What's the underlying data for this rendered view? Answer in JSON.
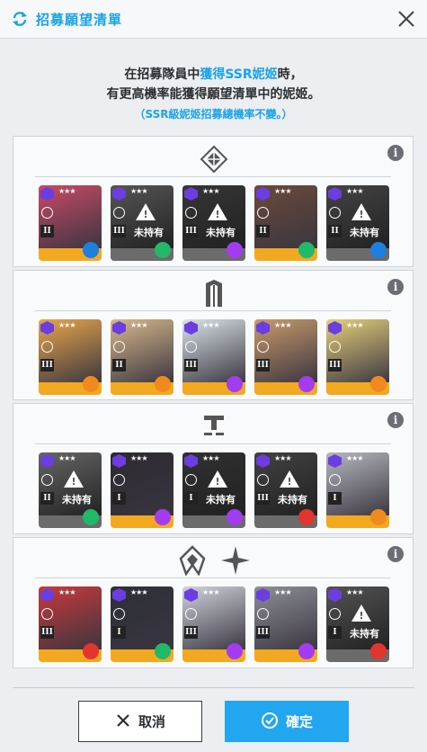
{
  "header": {
    "title": "招募願望清單",
    "refresh_icon": "refresh-icon",
    "close_icon": "close-icon"
  },
  "description": {
    "line1_prefix": "在招募隊員中",
    "line1_highlight": "獲得SSR妮姬",
    "line1_suffix": "時，",
    "line2": "有更高機率能獲得願望清單中的妮姬。",
    "note": "（SSR級妮姬招募總機率不變。）"
  },
  "colors": {
    "accent": "#1aa3e8",
    "owned_bar": "#f2a91f",
    "unowned_bar": "#6b6b6b",
    "burst_purple": "#7b2ff0",
    "electric": "#a33cf0",
    "fire": "#e3342f",
    "water": "#1e7fe0",
    "wind": "#21b86a",
    "iron": "#f08a1e"
  },
  "sections": [
    {
      "id": "elysion",
      "logo_icon": "elysion-diamond-icon",
      "info": "i",
      "cards": [
        {
          "owned": true,
          "burst": "II",
          "element": "water",
          "art": "#c94a66"
        },
        {
          "owned": false,
          "burst": "III",
          "element": "wind",
          "art": "#8a8f96",
          "label": "未持有"
        },
        {
          "owned": false,
          "burst": "III",
          "element": "electric",
          "art": "#555a63",
          "label": "未持有"
        },
        {
          "owned": true,
          "burst": "II",
          "element": "wind",
          "art": "#6b4a3a"
        },
        {
          "owned": false,
          "burst": "II",
          "element": "water",
          "art": "#8c6a5a",
          "label": "未持有"
        }
      ]
    },
    {
      "id": "missilis",
      "logo_icon": "missilis-m-icon",
      "info": "i",
      "cards": [
        {
          "owned": true,
          "burst": "III",
          "element": "iron",
          "art": "#e8a64a"
        },
        {
          "owned": true,
          "burst": "II",
          "element": "iron",
          "art": "#d8b88a"
        },
        {
          "owned": true,
          "burst": "III",
          "element": "electric",
          "art": "#d9e3e8"
        },
        {
          "owned": true,
          "burst": "III",
          "element": "electric",
          "art": "#c99a6a"
        },
        {
          "owned": true,
          "burst": "III",
          "element": "iron",
          "art": "#e6cf7a"
        }
      ]
    },
    {
      "id": "tetra",
      "logo_icon": "tetra-t-icon",
      "info": "i",
      "cards": [
        {
          "owned": false,
          "burst": "II",
          "element": "wind",
          "art": "#b8a88a",
          "label": "未持有"
        },
        {
          "owned": true,
          "burst": "I",
          "element": "electric",
          "art": "#2c2a30"
        },
        {
          "owned": false,
          "burst": "I",
          "element": "electric",
          "art": "#5a5048",
          "label": "未持有"
        },
        {
          "owned": false,
          "burst": "III",
          "element": "fire",
          "art": "#7a6a60",
          "label": "未持有"
        },
        {
          "owned": true,
          "burst": "I",
          "element": "iron",
          "art": "#b6b8bf"
        }
      ]
    },
    {
      "id": "pilgrim-abnormal",
      "logo_icon": "pilgrim-icon",
      "logo_icon_2": "abnormal-star-icon",
      "info": "i",
      "cards": [
        {
          "owned": true,
          "burst": "III",
          "element": "fire",
          "art": "#c83a3a"
        },
        {
          "owned": true,
          "burst": "I",
          "element": "wind",
          "art": "#2c3038"
        },
        {
          "owned": true,
          "burst": "III",
          "element": "electric",
          "art": "#cfd3db"
        },
        {
          "owned": true,
          "burst": "III",
          "element": "electric",
          "art": "#8d8f96"
        },
        {
          "owned": false,
          "burst": "I",
          "element": "fire",
          "art": "#c67a82",
          "label": "未持有"
        }
      ]
    }
  ],
  "buttons": {
    "cancel": "取消",
    "confirm": "確定"
  }
}
